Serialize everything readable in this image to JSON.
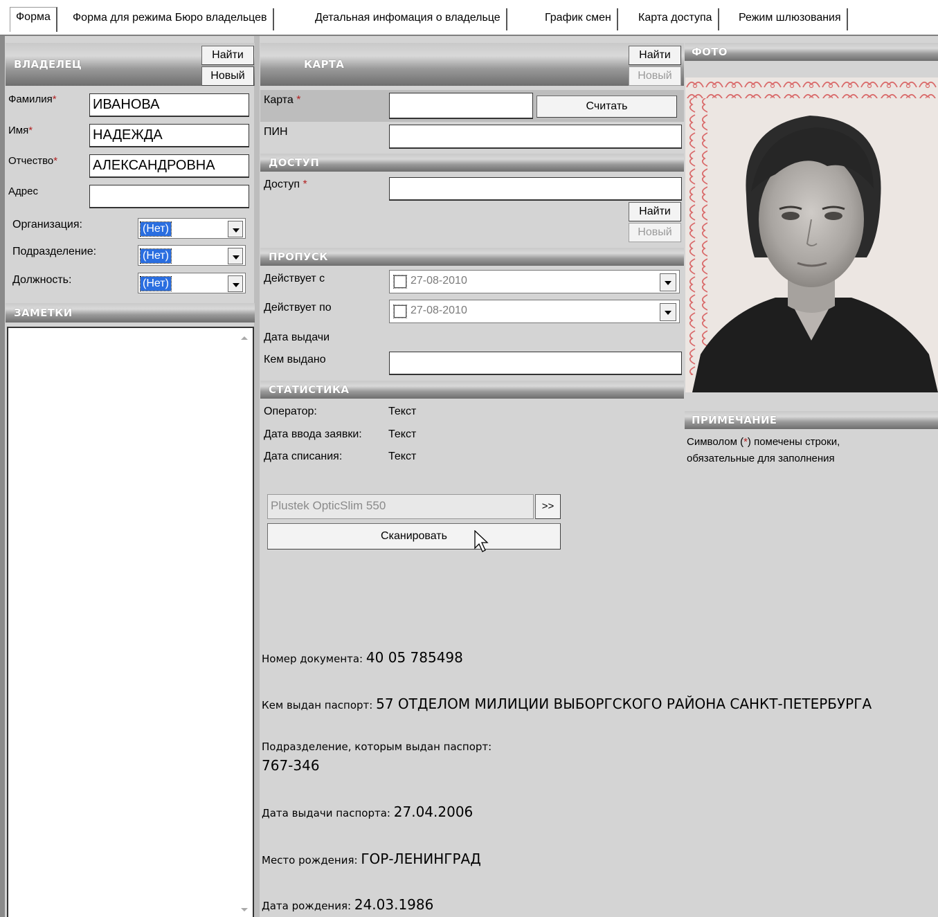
{
  "tabs": [
    "Форма",
    "Форма для режима Бюро владельцев",
    "Детальная инфомация о владельце",
    "График смен",
    "Карта доступа",
    "Режим шлюзования"
  ],
  "owner": {
    "header": "ВЛАДЕЛЕЦ",
    "find": "Найти",
    "new": "Новый",
    "surname_label": "Фамилия",
    "surname": "ИВАНОВА",
    "name_label": "Имя",
    "name": "НАДЕЖДА",
    "patronymic_label": "Отчество",
    "patronymic": "АЛЕКСАНДРОВНА",
    "address_label": "Адрес",
    "address": "",
    "org_label": "Организация:",
    "org": "(Нет)",
    "dept_label": "Подразделение:",
    "dept": "(Нет)",
    "position_label": "Должность:",
    "position": "(Нет)",
    "req": "*"
  },
  "notes": {
    "header": "ЗАМЕТКИ"
  },
  "card": {
    "header": "КАРТА",
    "find": "Найти",
    "new": "Новый",
    "card_label": "Карта",
    "read_btn": "Считать",
    "pin_label": "ПИН",
    "req": "*"
  },
  "access": {
    "header": "ДОСТУП",
    "access_label": "Доступ",
    "find": "Найти",
    "new": "Новый",
    "req": "*"
  },
  "pass": {
    "header": "ПРОПУСК",
    "valid_from_label": "Действует с",
    "valid_from": "27-08-2010",
    "valid_to_label": "Действует по",
    "valid_to": "27-08-2010",
    "issue_date_label": "Дата выдачи",
    "issued_by_label": "Кем выдано"
  },
  "stats": {
    "header": "СТАТИСТИКА",
    "operator_label": "Оператор:",
    "operator": "Текст",
    "request_date_label": "Дата ввода заявки:",
    "request_date": "Текст",
    "writeoff_label": "Дата списания:",
    "writeoff": "Текст"
  },
  "scanner": {
    "device": "Plustek OpticSlim 550",
    "more": ">>",
    "scan": "Сканировать"
  },
  "passport": {
    "doc_num_label": "Номер документа:",
    "doc_num": "40 05 785498",
    "issued_by_label": "Кем выдан паспорт:",
    "issued_by": "57 ОТДЕЛОМ МИЛИЦИИ ВЫБОРГСКОГО РАЙОНА САНКТ-ПЕТЕРБУРГА",
    "dept_label": "Подразделение, которым выдан паспорт:",
    "dept": "767-346",
    "issue_date_label": "Дата выдачи паспорта:",
    "issue_date": "27.04.2006",
    "birthplace_label": "Место рождения:",
    "birthplace": "ГОР-ЛЕНИНГРАД",
    "birthdate_label": "Дата рождения:",
    "birthdate": "24.03.1986"
  },
  "photo": {
    "header": "ФОТО"
  },
  "note": {
    "header": "ПРИМЕЧАНИЕ",
    "text1": "Символом (",
    "star": "*",
    "text2": ") помечены строки,",
    "text3": "обязательные для заполнения"
  }
}
